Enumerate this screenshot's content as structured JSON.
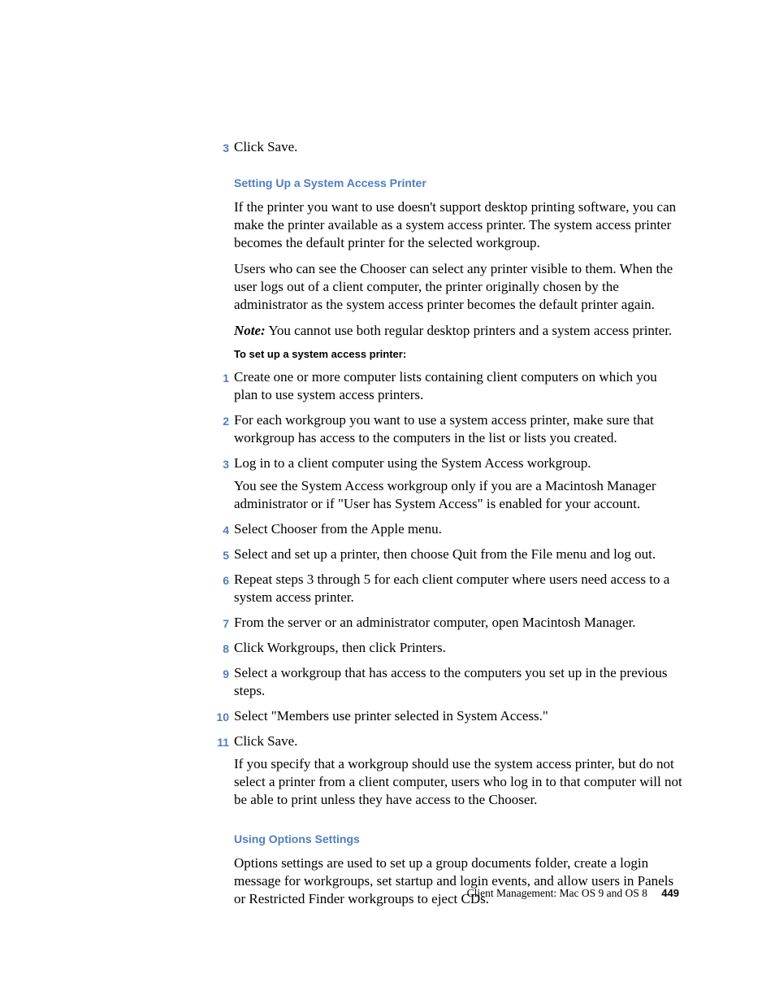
{
  "initial_step": {
    "num": "3",
    "text": "Click Save."
  },
  "section1": {
    "heading": "Setting Up a System Access Printer",
    "para1": "If the printer you want to use doesn't support desktop printing software, you can make the printer available as a system access printer. The system access printer becomes the default printer for the selected workgroup.",
    "para2": "Users who can see the Chooser can select any printer visible to them. When the user logs out of a client computer, the printer originally chosen by the administrator as the system access printer becomes the default printer again.",
    "note_label": "Note:",
    "note_text": "  You cannot use both regular desktop printers and a system access printer.",
    "subheading": "To set up a system access printer:",
    "steps": [
      {
        "num": "1",
        "text": "Create one or more computer lists containing client computers on which you plan to use system access printers."
      },
      {
        "num": "2",
        "text": "For each workgroup you want to use a system access printer, make sure that workgroup has access to the computers in the list or lists you created."
      },
      {
        "num": "3",
        "text": "Log in to a client computer using the System Access workgroup.",
        "extra": "You see the System Access workgroup only if you are a Macintosh Manager administrator or if \"User has System Access\" is enabled for your account."
      },
      {
        "num": "4",
        "text": "Select Chooser from the Apple menu."
      },
      {
        "num": "5",
        "text": "Select and set up a printer, then choose Quit from the File menu and log out."
      },
      {
        "num": "6",
        "text": "Repeat steps 3 through 5 for each client computer where users need access to a system access printer."
      },
      {
        "num": "7",
        "text": "From the server or an administrator computer, open Macintosh Manager."
      },
      {
        "num": "8",
        "text": "Click Workgroups, then click Printers."
      },
      {
        "num": "9",
        "text": "Select a workgroup that has access to the computers you set up in the previous steps."
      },
      {
        "num": "10",
        "text": "Select \"Members use printer selected in System Access.\""
      },
      {
        "num": "11",
        "text": "Click Save.",
        "extra": "If you specify that a workgroup should use the system access printer, but do not select a printer from a client computer, users who log in to that computer will not be able to print unless they have access to the Chooser."
      }
    ]
  },
  "section2": {
    "heading": "Using Options Settings",
    "para1": "Options settings are used to set up a group documents folder, create a login message for workgroups, set startup and login events, and allow users in Panels or Restricted Finder workgroups to eject CDs."
  },
  "footer": {
    "chapter": "Client Management: Mac OS 9 and OS 8",
    "page": "449"
  }
}
